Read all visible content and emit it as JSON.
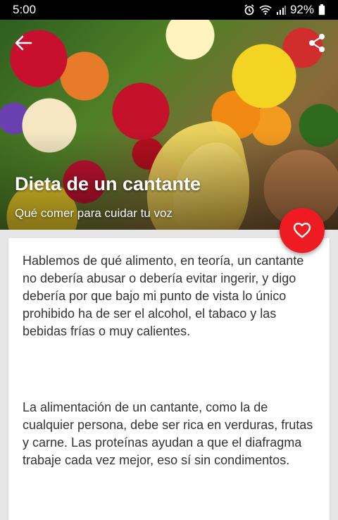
{
  "status_bar": {
    "time": "5:00",
    "battery_percent": "92%",
    "icons": [
      "alarm-icon",
      "wifi-icon",
      "signal-icon",
      "battery-icon"
    ]
  },
  "header": {
    "title": "Dieta de un cantante",
    "subtitle": "Qué comer para cuidar tu voz",
    "back_icon": "arrow-left-icon",
    "share_icon": "share-icon"
  },
  "fab": {
    "icon": "heart-outline-icon",
    "color": "#ef1b22"
  },
  "article": {
    "paragraphs": [
      "Hablemos de qué alimento, en teoría, un cantante no debería abusar o debería evitar ingerir, y digo debería por que bajo mi punto de vista lo único prohibido ha de ser el alcohol, el tabaco y las bebidas frías o muy calientes.",
      "La alimentación de un cantante, como la de cualquier persona, debe ser rica en verduras, frutas y carne. Las proteínas ayudan a que el diafragma trabaje cada vez mejor, eso sí sin condimentos."
    ]
  }
}
